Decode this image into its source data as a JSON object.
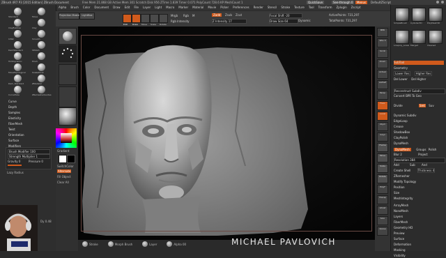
{
  "titlebar": {
    "app_title": "ZBrush 4R7 P3 [2015 Edition]   ZBrush Document",
    "stats": "Free Mem 21.868 GB  Active Mem 301  Scratch Disk 956  ZTime 1.839  Timer 0.071  PolyCount 728.6 KP  MeshCount 1",
    "quicksave": "QuickSave",
    "see_through": "See-through  0",
    "menus_label": "Menus",
    "default_script": "DefaultZScript"
  },
  "menubar": {
    "items": [
      "Alpha",
      "Brush",
      "Color",
      "Document",
      "Draw",
      "Edit",
      "File",
      "Layer",
      "Light",
      "Macro",
      "Marker",
      "Material",
      "Movie",
      "Picker",
      "Preferences",
      "Render",
      "Stencil",
      "Stroke",
      "Texture",
      "Tool",
      "Transform",
      "Zplugin",
      "Zscript"
    ]
  },
  "shelf": {
    "projection_master": "Projection Master",
    "lightbox": "LightBox",
    "edit": "Edit",
    "draw": "Draw",
    "move": "Move",
    "scale": "Scale",
    "rotate": "Rotate",
    "mrgb": "Mrgb",
    "rgb": "Rgb",
    "m": "M",
    "zadd": "Zadd",
    "zsub": "Zsub",
    "zcut": "Zcut",
    "rgb_intensity": "Rgb Intensity",
    "z_intensity": "Z Intensity 17",
    "focal_shift": "Focal Shift -20",
    "draw_size": "Draw Size 64",
    "dynamic": "Dynamic",
    "active_points": "ActivePoints: 731,297",
    "total_points": "TotalPoints: 731,297"
  },
  "left_tray": {
    "brushes": [
      "Standard",
      "Move",
      "ClayBuildup",
      "Clay",
      "Inflat",
      "Smooth",
      "DamStandard",
      "hPolish",
      "TrimDynamic",
      "Pinch",
      "MoveTopological",
      "SnakeHook",
      "Dam_Standard",
      "ZModeler",
      "CurveTube",
      "ZRemesherGuides"
    ],
    "menu_sections": [
      "Curve",
      "Depth",
      "Samples",
      "Elasticity",
      "FiberMesh",
      "Twist",
      "Orientation",
      "Surface",
      "Modifiers"
    ],
    "brush_modifier": "Brush Modifier 100",
    "strength_multiplier": "Strength Multiplier 1",
    "gravity": "Gravity 0",
    "pressure": "Pressure 0",
    "stroke_label": "Stroke",
    "alpha_label": "Alpha",
    "texture_label": "Texture Off",
    "gradient": "Gradient",
    "switch_color": "SwitchColor",
    "alternate": "Alternate",
    "fill_object": "Fill Object",
    "clear_all": "Clear All",
    "lazy_mouse": "Lazy Radius",
    "dyn_value": "Dy 0.48"
  },
  "left_shelf": {
    "projection_master": "Projection Master",
    "lightbox": "LightBox"
  },
  "right_shelf": {
    "buttons": [
      "BPR",
      "SPix 3",
      "Scroll",
      "Zoom",
      "Actual",
      "AAHalf",
      "Persp",
      "Floor",
      "Local",
      "LSym",
      "Gxyz",
      "Frame",
      "Move",
      "Scale",
      "Rotate",
      "PolyF",
      "Transp",
      "Ghost",
      "Solo",
      "Xpose"
    ]
  },
  "right_tray": {
    "tools": [
      "SimpleBrush",
      "Cylinder3D",
      "PolyMesh3D",
      "Lowpoly_LowerLip",
      "Merged",
      "Cleaned"
    ],
    "subtool": "SubTool",
    "geometry": "Geometry",
    "lower_res": "Lower Res",
    "higher_res": "Higher Res",
    "del_lower": "Del Lower",
    "del_higher": "Del Higher",
    "reconstruct": "Reconstruct Subdiv",
    "convert_bpr": "Convert BPR To Geo",
    "divide": "Divide",
    "smt": "Smt",
    "suv": "Suv",
    "dynamic_subdiv": "Dynamic Subdiv",
    "edgeloop": "EdgeLoop",
    "crease": "Crease",
    "shadowbox": "ShadowBox",
    "claypolish": "ClayPolish",
    "dynamesh_section": "DynaMesh",
    "dynamesh_btn": "DynaMesh",
    "groups": "Groups",
    "polish": "Polish",
    "blur": "Blur 2",
    "project": "Project",
    "resolution": "Resolution 384",
    "add": "Add",
    "sub": "Sub",
    "and": "And",
    "create_shell": "Create Shell",
    "thickness": "Thickness 4",
    "zremesher": "ZRemesher",
    "modify_topology": "Modify Topology",
    "position": "Position",
    "size": "Size",
    "meshintegrity": "MeshIntegrity",
    "sections": [
      "ArrayMesh",
      "NanoMesh",
      "Layers",
      "FiberMesh",
      "Geometry HD",
      "Preview",
      "Surface",
      "Deformation",
      "Masking",
      "Visibility"
    ]
  },
  "bottom_shelf": {
    "items": [
      "Stroke",
      "Morph Brush",
      "Layer",
      "Alpha 00"
    ]
  },
  "watermark": "MICHAEL PAVLOVICH"
}
